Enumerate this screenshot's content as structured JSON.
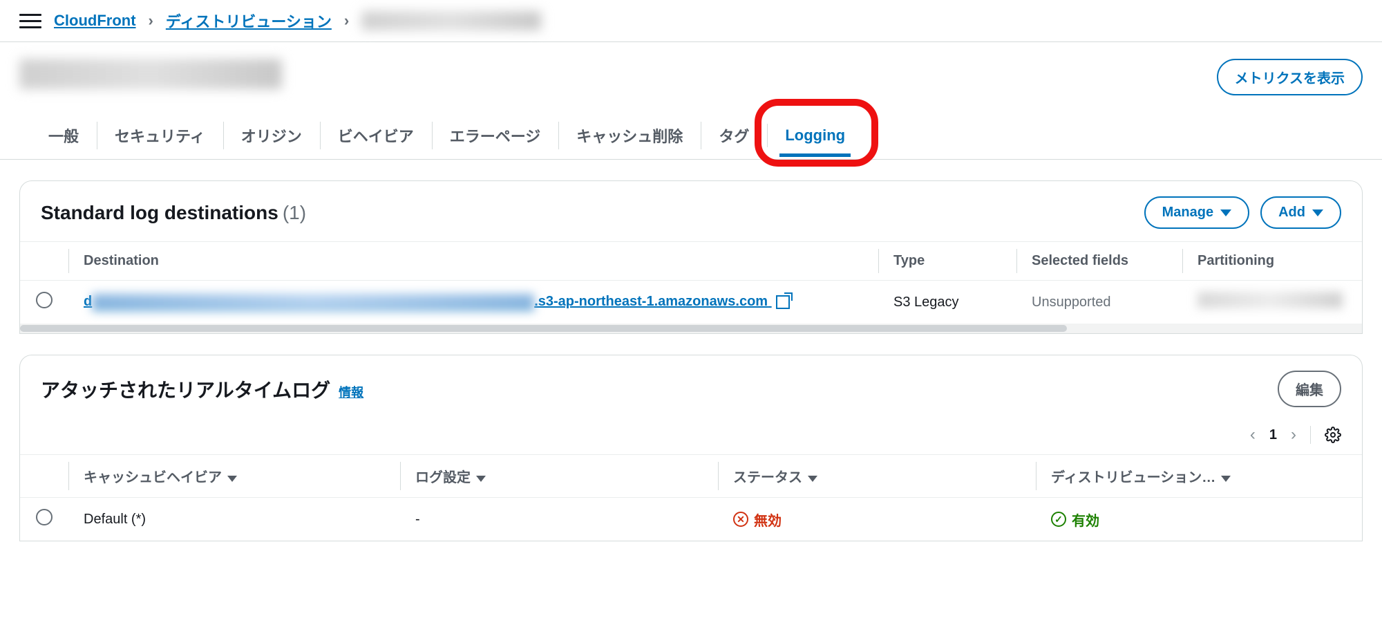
{
  "breadcrumb": {
    "root": "CloudFront",
    "level1": "ディストリビューション",
    "level2_redacted": true
  },
  "header": {
    "title_redacted": true,
    "metrics_button": "メトリクスを表示"
  },
  "tabs": [
    {
      "id": "general",
      "label": "一般",
      "active": false
    },
    {
      "id": "security",
      "label": "セキュリティ",
      "active": false
    },
    {
      "id": "origins",
      "label": "オリジン",
      "active": false
    },
    {
      "id": "behaviors",
      "label": "ビヘイビア",
      "active": false
    },
    {
      "id": "errorpages",
      "label": "エラーページ",
      "active": false
    },
    {
      "id": "invalidation",
      "label": "キャッシュ削除",
      "active": false
    },
    {
      "id": "tags",
      "label": "タグ",
      "active": false
    },
    {
      "id": "logging",
      "label": "Logging",
      "active": true,
      "highlighted": true
    }
  ],
  "std_log": {
    "title": "Standard log destinations",
    "count": "(1)",
    "manage_btn": "Manage",
    "add_btn": "Add",
    "columns": {
      "destination": "Destination",
      "type": "Type",
      "selected_fields": "Selected fields",
      "partitioning": "Partitioning"
    },
    "rows": [
      {
        "dest_prefix": "d",
        "dest_redacted": true,
        "dest_suffix": ".s3-ap-northeast-1.amazonaws.com",
        "type": "S3 Legacy",
        "selected_fields": "Unsupported",
        "partitioning_redacted": true
      }
    ]
  },
  "rt_log": {
    "title": "アタッチされたリアルタイムログ",
    "info_label": "情報",
    "edit_btn": "編集",
    "page_number": "1",
    "columns": {
      "behavior": "キャッシュビヘイビア",
      "config": "ログ設定",
      "status": "ステータス",
      "distribution": "ディストリビューション…"
    },
    "rows": [
      {
        "behavior": "Default (*)",
        "config": "-",
        "status_label": "無効",
        "status_kind": "bad",
        "distribution_label": "有効",
        "distribution_kind": "good"
      }
    ]
  }
}
